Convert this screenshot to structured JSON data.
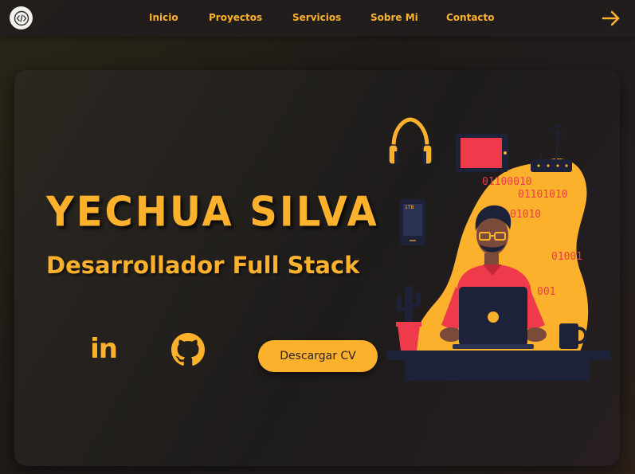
{
  "nav": {
    "logo_icon": "code-icon",
    "links": [
      "Inicio",
      "Proyectos",
      "Servicios",
      "Sobre Mi",
      "Contacto"
    ],
    "cta_icon": "arrow-right-icon"
  },
  "hero": {
    "name": "YECHUA SILVA",
    "role": "Desarrollador Full Stack",
    "social": {
      "linkedin_label": "in",
      "github_icon": "github-icon"
    },
    "cv_button": "Descargar CV",
    "binary": [
      "01100010",
      "01101010",
      "01010",
      "01001",
      "001"
    ]
  },
  "colors": {
    "accent": "#fbb12c",
    "background": "#1f1c1a",
    "nav": "#221e1c",
    "red": "#ef3a4c",
    "navy": "#1d2238"
  }
}
